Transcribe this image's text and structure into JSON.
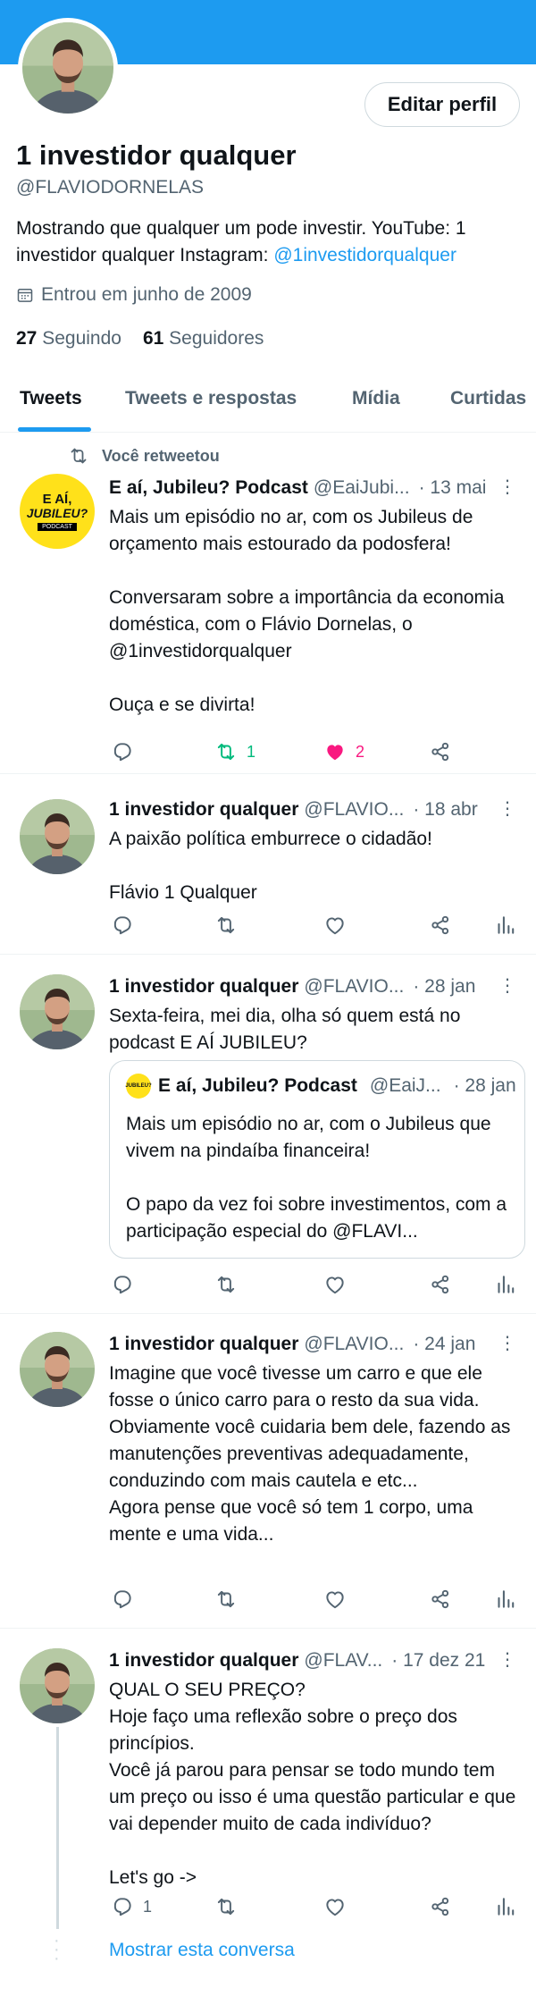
{
  "profile": {
    "edit_label": "Editar perfil",
    "name": "1 investidor qualquer",
    "handle": "@FLAVIODORNELAS",
    "bio_text": "Mostrando que qualquer um pode investir. YouTube: 1 investidor qualquer Instagram: ",
    "bio_link": "@1investidorqualquer",
    "joined": "Entrou em junho de 2009",
    "following_count": "27",
    "following_label": "Seguindo",
    "followers_count": "61",
    "followers_label": "Seguidores"
  },
  "tabs": [
    {
      "label": "Tweets",
      "active": true
    },
    {
      "label": "Tweets e respostas",
      "active": false
    },
    {
      "label": "Mídia",
      "active": false
    },
    {
      "label": "Curtidas",
      "active": false
    }
  ],
  "retweet_label": "Você retweetou",
  "podcast_logo": {
    "line1": "E AÍ,",
    "line2": "JUBILEU?",
    "line3": "PODCAST"
  },
  "tweets": [
    {
      "name": "E aí, Jubileu? Podcast",
      "handle": "@EaiJubi...",
      "date": "· 13 mai",
      "text": "Mais um episódio no ar, com os Jubileus de orçamento mais estourado da podosfera!\n\nConversaram sobre a importância da economia doméstica, com o Flávio Dornelas, o @1investidorqualquer\n\nOuça e se divirta!",
      "retweets": "1",
      "likes": "2"
    },
    {
      "name": "1 investidor qualquer",
      "handle": "@FLAVIO...",
      "date": "· 18 abr",
      "text": "A paixão política emburrece o cidadão!\n\nFlávio 1 Qualquer"
    },
    {
      "name": "1 investidor qualquer",
      "handle": "@FLAVIO...",
      "date": "· 28 jan",
      "text": "Sexta-feira, mei dia, olha só quem está no podcast E AÍ JUBILEU?",
      "quote": {
        "name": "E aí, Jubileu? Podcast",
        "handle": "@EaiJ...",
        "date": "· 28 jan",
        "text": "Mais um episódio no ar, com o Jubileus que vivem na pindaíba financeira!\n\nO papo da vez foi sobre investimentos, com a participação especial do @FLAVI..."
      }
    },
    {
      "name": "1 investidor qualquer",
      "handle": "@FLAVIO...",
      "date": "· 24 jan",
      "text": "Imagine que você tivesse um carro e que ele fosse o único carro para o resto da sua vida. Obviamente você cuidaria bem dele, fazendo as manutenções preventivas adequadamente, conduzindo com mais cautela e etc...\nAgora pense que você só tem 1 corpo, uma mente e uma vida..."
    },
    {
      "name": "1 investidor qualquer",
      "handle": "@FLAV...",
      "date": "· 17 dez 21",
      "text": "QUAL O SEU PREÇO?\nHoje faço uma reflexão sobre o preço dos princípios.\nVocê já parou para pensar se todo mundo tem um preço ou isso é uma questão particular e que vai depender muito de cada indivíduo?\n\nLet's go ->",
      "replies": "1"
    }
  ],
  "show_conversation": "Mostrar esta conversa",
  "colors": {
    "accent": "#1d9bf0",
    "retweet": "#00ba7c",
    "like": "#f91880",
    "muted": "#536471"
  }
}
